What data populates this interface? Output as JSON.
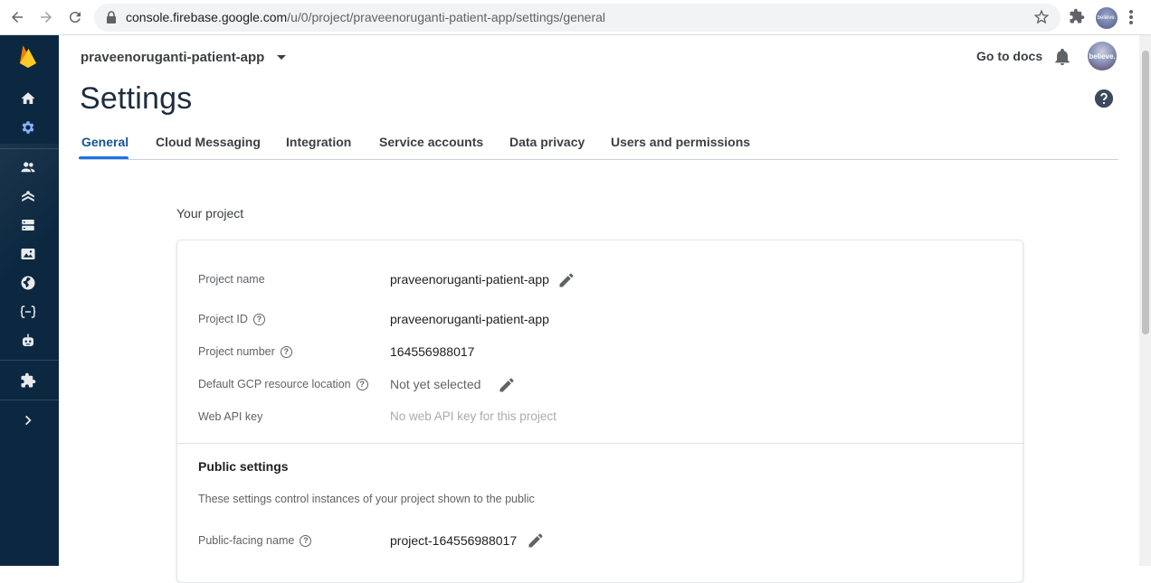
{
  "browser": {
    "url_host": "console.firebase.google.com",
    "url_path": "/u/0/project/praveenoruganti-patient-app/settings/general",
    "profile_label": "believe."
  },
  "sidebar": {
    "items": [
      {
        "name": "home",
        "icon": "home-icon"
      },
      {
        "name": "settings",
        "icon": "gear-icon"
      },
      {
        "name": "authentication",
        "icon": "users-icon"
      },
      {
        "name": "firestore",
        "icon": "firestore-icon"
      },
      {
        "name": "database",
        "icon": "database-icon"
      },
      {
        "name": "storage",
        "icon": "storage-icon"
      },
      {
        "name": "hosting",
        "icon": "globe-icon"
      },
      {
        "name": "functions",
        "icon": "functions-icon"
      },
      {
        "name": "ml",
        "icon": "robot-icon"
      },
      {
        "name": "extensions",
        "icon": "puzzle-icon"
      },
      {
        "name": "expand",
        "icon": "chevron-right-icon"
      }
    ]
  },
  "header": {
    "project_name": "praveenoruganti-patient-app",
    "docs_label": "Go to docs",
    "avatar_label": "believe.",
    "title": "Settings"
  },
  "tabs": [
    {
      "label": "General",
      "active": true
    },
    {
      "label": "Cloud Messaging",
      "active": false
    },
    {
      "label": "Integration",
      "active": false
    },
    {
      "label": "Service accounts",
      "active": false
    },
    {
      "label": "Data privacy",
      "active": false
    },
    {
      "label": "Users and permissions",
      "active": false
    }
  ],
  "project": {
    "heading": "Your project",
    "fields": {
      "name_label": "Project name",
      "name_value": "praveenoruganti-patient-app",
      "id_label": "Project ID",
      "id_value": "praveenoruganti-patient-app",
      "number_label": "Project number",
      "number_value": "164556988017",
      "location_label": "Default GCP resource location",
      "location_value": "Not yet selected",
      "api_label": "Web API key",
      "api_value": "No web API key for this project"
    },
    "public": {
      "title": "Public settings",
      "description": "These settings control instances of your project shown to the public",
      "facing_label": "Public-facing name",
      "facing_value": "project-164556988017"
    }
  },
  "colors": {
    "sidebar_bg": "#0c2840",
    "accent": "#1a73e8",
    "active_tab": "#1a5296"
  }
}
